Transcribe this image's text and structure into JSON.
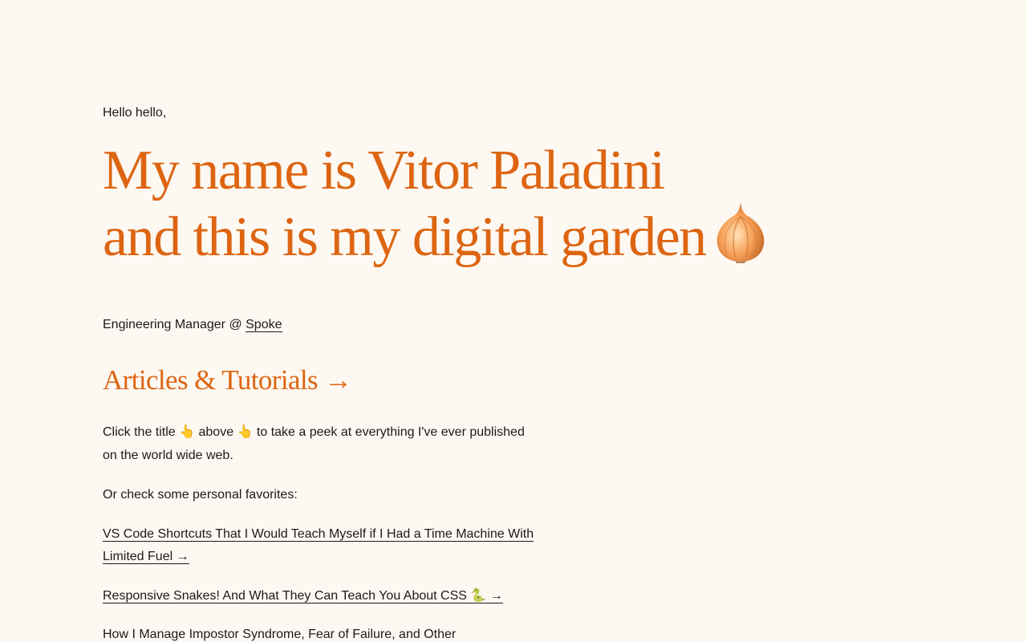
{
  "intro": {
    "greeting": "Hello hello,",
    "hero_line1": "My name is Vitor Paladini",
    "hero_line2": "and this is my digital garden",
    "hero_emoji": "onion-icon",
    "role_prefix": "Engineering Manager @ ",
    "company_link": "Spoke"
  },
  "articles": {
    "section_title": "Articles & Tutorials →",
    "description": "Click the title 👆 above 👆 to take a peek at everything I've ever published on the world wide web.",
    "favorites_intro": "Or check some personal favorites:",
    "favorites": [
      "VS Code Shortcuts That I Would Teach Myself if I Had a Time Machine With Limited Fuel →",
      "Responsive Snakes! And What They Can Teach You About CSS 🐍 →",
      "How I Manage Impostor Syndrome, Fear of Failure, and Other"
    ]
  },
  "colors": {
    "background": "#fdf8f2",
    "accent": "#dd6512",
    "text": "#1c1a18"
  }
}
